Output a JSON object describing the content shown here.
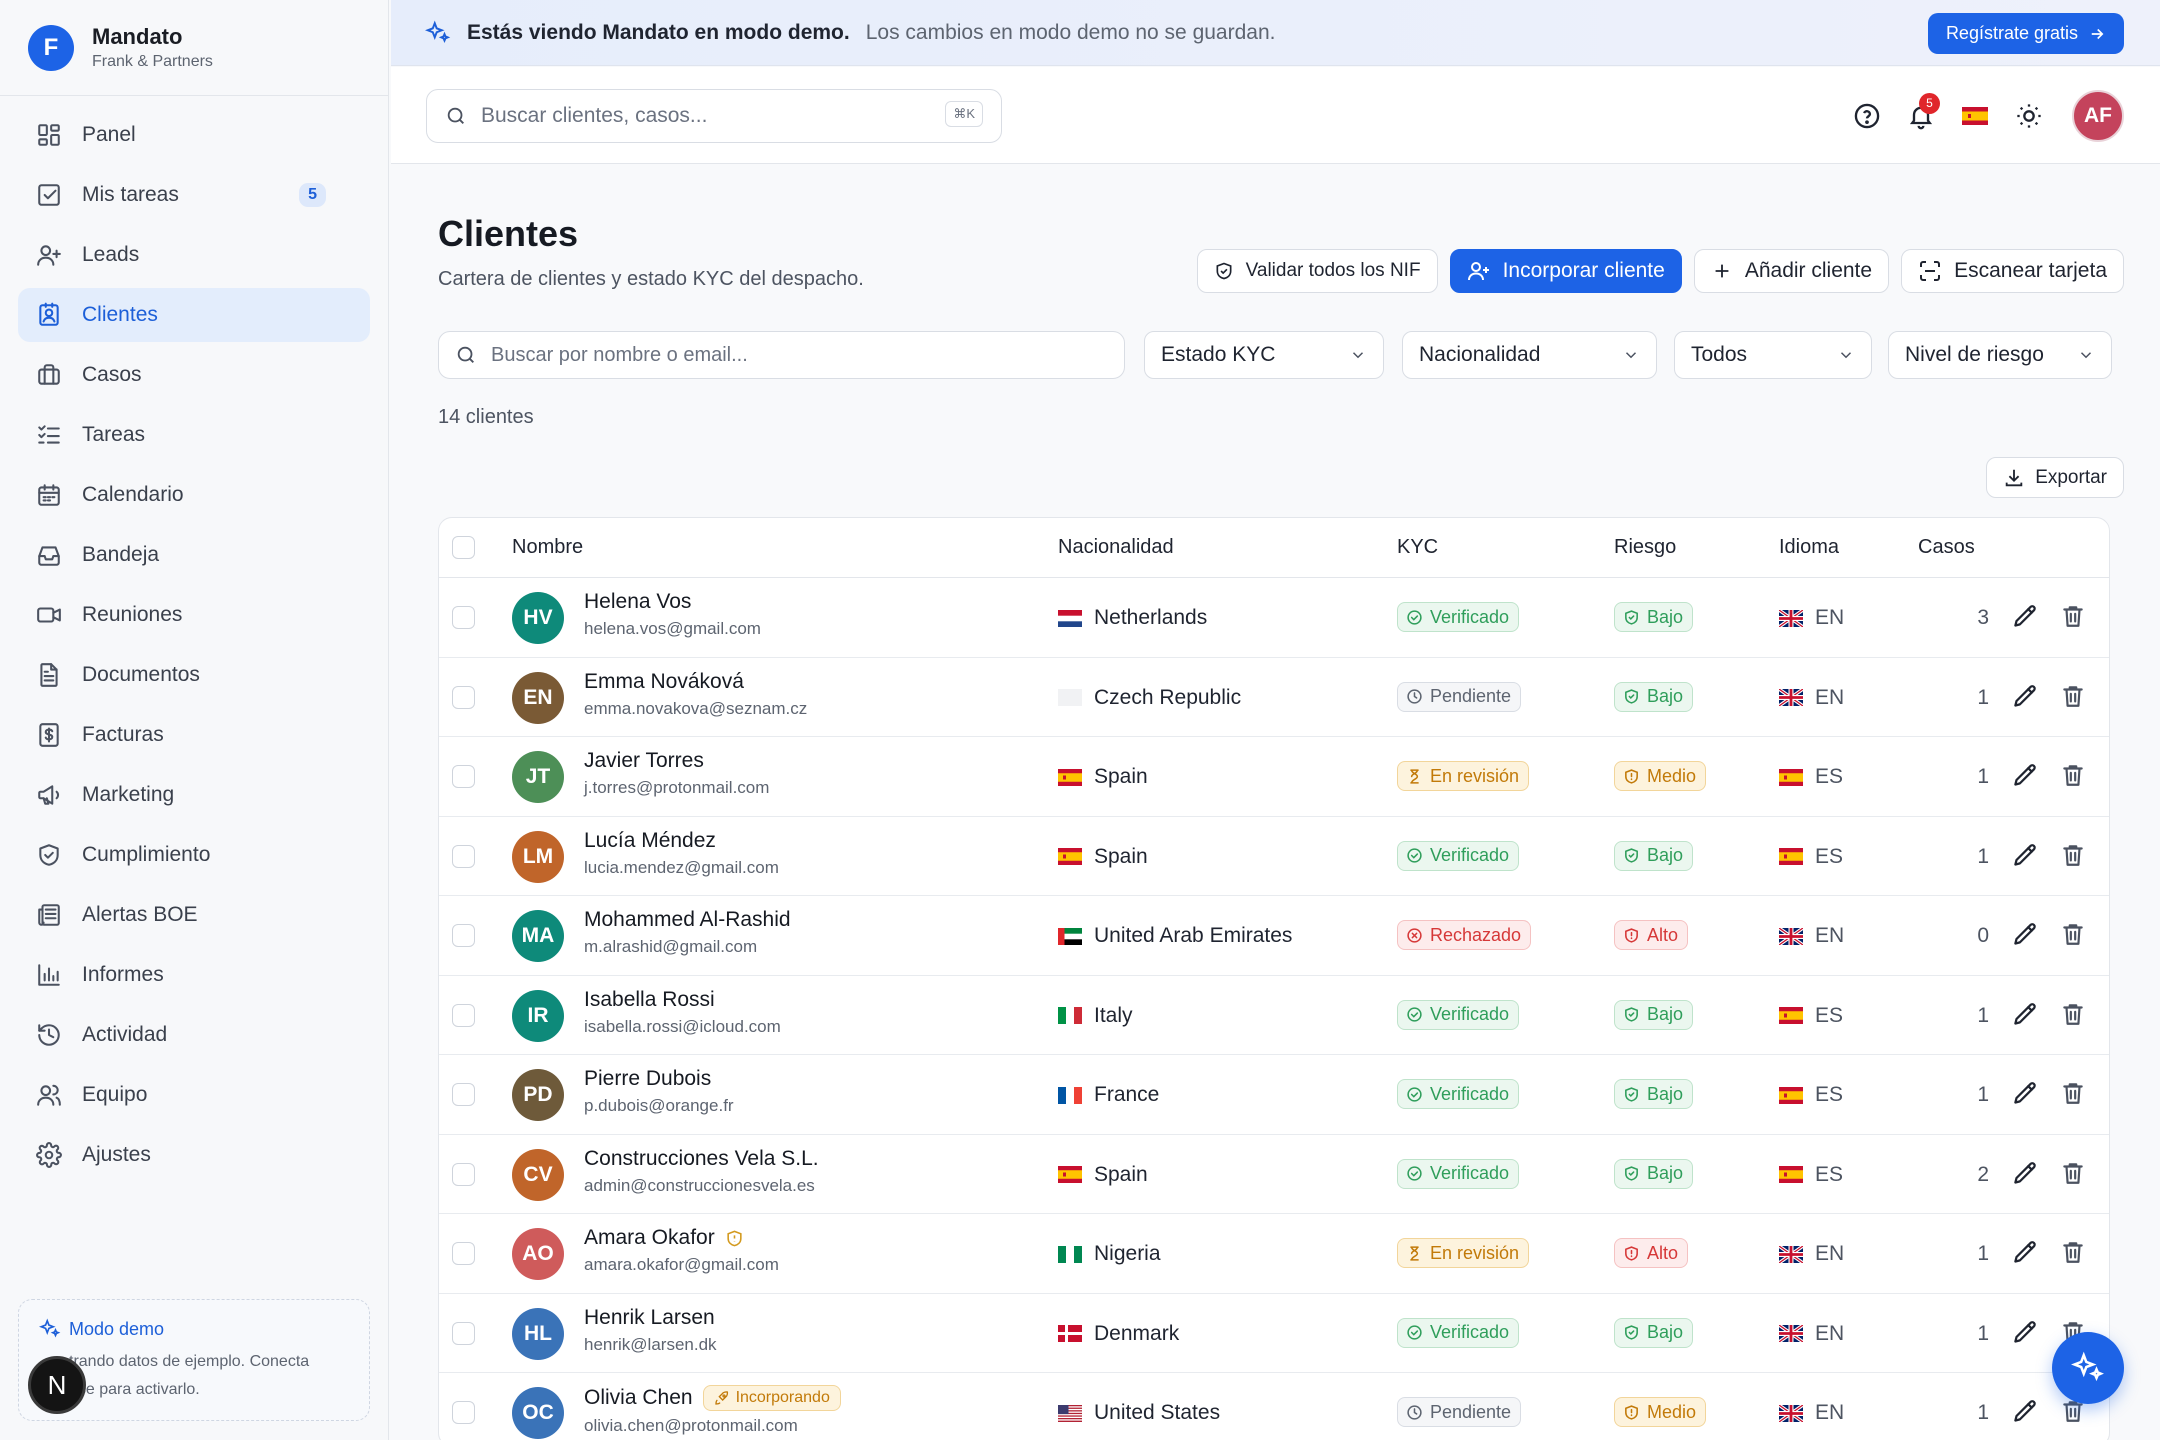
{
  "brand": {
    "logo_letter": "F",
    "name": "Mandato",
    "subtitle": "Frank & Partners"
  },
  "sidebar": {
    "items": [
      {
        "label": "Panel",
        "icon": "grid-icon"
      },
      {
        "label": "Mis tareas",
        "icon": "checkbox-icon",
        "badge": "5"
      },
      {
        "label": "Leads",
        "icon": "user-plus-icon"
      },
      {
        "label": "Clientes",
        "icon": "contact-card-icon",
        "active": true
      },
      {
        "label": "Casos",
        "icon": "briefcase-icon"
      },
      {
        "label": "Tareas",
        "icon": "list-check-icon"
      },
      {
        "label": "Calendario",
        "icon": "calendar-icon"
      },
      {
        "label": "Bandeja",
        "icon": "inbox-icon"
      },
      {
        "label": "Reuniones",
        "icon": "video-icon"
      },
      {
        "label": "Documentos",
        "icon": "document-icon"
      },
      {
        "label": "Facturas",
        "icon": "invoice-icon"
      },
      {
        "label": "Marketing",
        "icon": "megaphone-icon"
      },
      {
        "label": "Cumplimiento",
        "icon": "shield-icon"
      },
      {
        "label": "Alertas BOE",
        "icon": "newspaper-icon"
      },
      {
        "label": "Informes",
        "icon": "bar-chart-icon"
      },
      {
        "label": "Actividad",
        "icon": "history-icon"
      },
      {
        "label": "Equipo",
        "icon": "users-icon"
      },
      {
        "label": "Ajustes",
        "icon": "gear-icon"
      }
    ],
    "demo": {
      "title": "Modo demo",
      "text_1": "trando datos de ejemplo. Conecta",
      "text_2": "ase para activarlo."
    },
    "dev_badge": "N"
  },
  "banner": {
    "strong": "Estás viendo Mandato en modo demo.",
    "soft": "Los cambios en modo demo no se guardan.",
    "cta": "Regístrate gratis"
  },
  "topbar": {
    "search_placeholder": "Buscar clientes, casos...",
    "shortcut": "⌘K",
    "notifications_count": "5",
    "user_initials": "AF"
  },
  "page": {
    "title": "Clientes",
    "subtitle": "Cartera de clientes y estado KYC del despacho.",
    "actions": {
      "validate_nif": "Validar todos los NIF",
      "onboard": "Incorporar cliente",
      "add": "Añadir cliente",
      "scan": "Escanear tarjeta"
    },
    "filters": {
      "search_placeholder": "Buscar por nombre o email...",
      "kyc": "Estado KYC",
      "nationality": "Nacionalidad",
      "type": "Todos",
      "risk": "Nivel de riesgo"
    },
    "count": "14 clientes",
    "export": "Exportar"
  },
  "table": {
    "columns": {
      "name": "Nombre",
      "nationality": "Nacionalidad",
      "kyc": "KYC",
      "risk": "Riesgo",
      "language": "Idioma",
      "cases": "Casos"
    },
    "rows": [
      {
        "initials": "HV",
        "avatar_color": "#0e8a7a",
        "name": "Helena Vos",
        "email": "helena.vos@gmail.com",
        "nationality": "Netherlands",
        "flag": "nl",
        "kyc": "Verificado",
        "kyc_status": "ok",
        "risk": "Bajo",
        "risk_level": "low",
        "lang": "EN",
        "lang_flag": "gb",
        "cases": "3"
      },
      {
        "initials": "EN",
        "avatar_color": "#7a5a35",
        "name": "Emma Nováková",
        "email": "emma.novakova@seznam.cz",
        "nationality": "Czech Republic",
        "flag": "none",
        "kyc": "Pendiente",
        "kyc_status": "pending",
        "risk": "Bajo",
        "risk_level": "low",
        "lang": "EN",
        "lang_flag": "gb",
        "cases": "1"
      },
      {
        "initials": "JT",
        "avatar_color": "#4d8f57",
        "name": "Javier Torres",
        "email": "j.torres@protonmail.com",
        "nationality": "Spain",
        "flag": "es",
        "kyc": "En revisión",
        "kyc_status": "review",
        "risk": "Medio",
        "risk_level": "medium",
        "lang": "ES",
        "lang_flag": "es",
        "cases": "1"
      },
      {
        "initials": "LM",
        "avatar_color": "#c0652a",
        "name": "Lucía Méndez",
        "email": "lucia.mendez@gmail.com",
        "nationality": "Spain",
        "flag": "es",
        "kyc": "Verificado",
        "kyc_status": "ok",
        "risk": "Bajo",
        "risk_level": "low",
        "lang": "ES",
        "lang_flag": "es",
        "cases": "1"
      },
      {
        "initials": "MA",
        "avatar_color": "#0e8a7a",
        "name": "Mohammed Al-Rashid",
        "email": "m.alrashid@gmail.com",
        "nationality": "United Arab Emirates",
        "flag": "ae",
        "kyc": "Rechazado",
        "kyc_status": "rejected",
        "risk": "Alto",
        "risk_level": "high",
        "lang": "EN",
        "lang_flag": "gb",
        "cases": "0"
      },
      {
        "initials": "IR",
        "avatar_color": "#0e8a7a",
        "name": "Isabella Rossi",
        "email": "isabella.rossi@icloud.com",
        "nationality": "Italy",
        "flag": "it",
        "kyc": "Verificado",
        "kyc_status": "ok",
        "risk": "Bajo",
        "risk_level": "low",
        "lang": "ES",
        "lang_flag": "es",
        "cases": "1"
      },
      {
        "initials": "PD",
        "avatar_color": "#6e5a3a",
        "name": "Pierre Dubois",
        "email": "p.dubois@orange.fr",
        "nationality": "France",
        "flag": "fr",
        "kyc": "Verificado",
        "kyc_status": "ok",
        "risk": "Bajo",
        "risk_level": "low",
        "lang": "ES",
        "lang_flag": "es",
        "cases": "1"
      },
      {
        "initials": "CV",
        "avatar_color": "#c0652a",
        "name": "Construcciones Vela S.L.",
        "email": "admin@construccionesvela.es",
        "nationality": "Spain",
        "flag": "es",
        "kyc": "Verificado",
        "kyc_status": "ok",
        "risk": "Bajo",
        "risk_level": "low",
        "lang": "ES",
        "lang_flag": "es",
        "cases": "2"
      },
      {
        "initials": "AO",
        "avatar_color": "#cf5b5b",
        "name": "Amara Okafor",
        "email": "amara.okafor@gmail.com",
        "nationality": "Nigeria",
        "flag": "ng",
        "kyc": "En revisión",
        "kyc_status": "review",
        "risk": "Alto",
        "risk_level": "high",
        "lang": "EN",
        "lang_flag": "gb",
        "cases": "1",
        "shield": true
      },
      {
        "initials": "HL",
        "avatar_color": "#3a73b8",
        "name": "Henrik Larsen",
        "email": "henrik@larsen.dk",
        "nationality": "Denmark",
        "flag": "dk",
        "kyc": "Verificado",
        "kyc_status": "ok",
        "risk": "Bajo",
        "risk_level": "low",
        "lang": "EN",
        "lang_flag": "gb",
        "cases": "1"
      },
      {
        "initials": "OC",
        "avatar_color": "#3a73b8",
        "name": "Olivia Chen",
        "email": "olivia.chen@protonmail.com",
        "nationality": "United States",
        "flag": "us",
        "kyc": "Pendiente",
        "kyc_status": "pending",
        "risk": "Medio",
        "risk_level": "medium",
        "lang": "EN",
        "lang_flag": "gb",
        "cases": "1",
        "tag": "Incorporando"
      }
    ]
  },
  "colors": {
    "primary": "#1d63e6",
    "ok": "#2f9e5b",
    "review": "#d98a0e",
    "rejected": "#dc3b3b",
    "pending": "#6b7280"
  }
}
